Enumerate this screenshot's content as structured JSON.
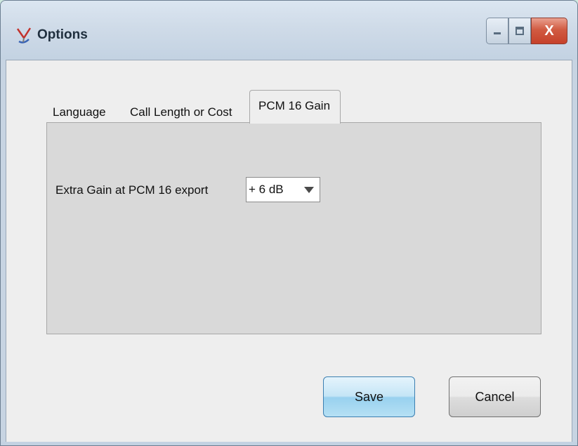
{
  "window": {
    "title": "Options",
    "icon": "app-logo-icon"
  },
  "caption_buttons": {
    "minimize_icon": "minimize-icon",
    "maximize_icon": "maximize-icon",
    "close_label": "X"
  },
  "tabs": [
    {
      "label": "Language",
      "active": false
    },
    {
      "label": "Call Length or Cost",
      "active": false
    },
    {
      "label": "PCM 16 Gain",
      "active": true
    }
  ],
  "pcm_gain": {
    "label": "Extra Gain at PCM 16 export",
    "selected": "+ 6 dB"
  },
  "buttons": {
    "save": "Save",
    "cancel": "Cancel"
  },
  "colors": {
    "accent_button": "#98d1ef",
    "close_button": "#c6412a",
    "window_frame": "#c7d4e2"
  }
}
